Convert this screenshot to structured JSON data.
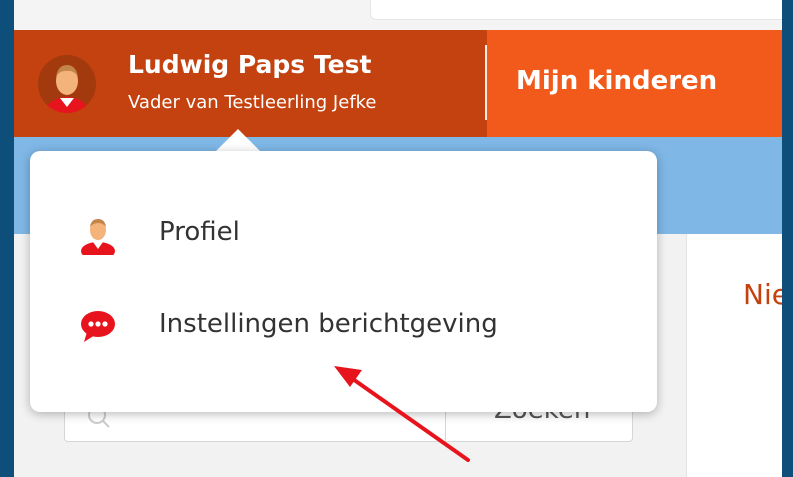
{
  "header": {
    "user_name": "Ludwig Paps Test",
    "user_role": "Vader van Testleerling Jefke",
    "nav_item": "Mijn kinderen"
  },
  "dropdown": {
    "items": [
      {
        "label": "Profiel",
        "icon": "user-avatar-icon"
      },
      {
        "label": "Instellingen berichtgeving",
        "icon": "speech-bubble-icon"
      }
    ]
  },
  "background": {
    "partial_title": "Nie",
    "search_button_label": "Zoeken"
  },
  "colors": {
    "header_user_bg": "#c4420f",
    "header_nav_bg": "#f25a1b",
    "subbar_bg": "#7fb7e6",
    "icon_red": "#e8141d",
    "annotation_arrow": "#e8141d"
  }
}
